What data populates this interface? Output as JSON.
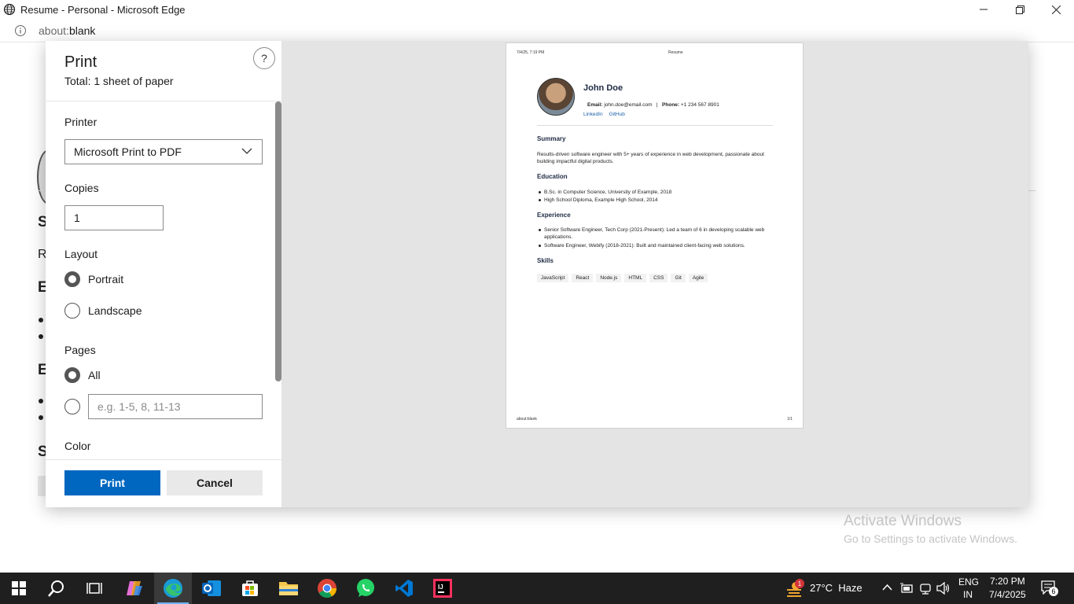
{
  "window": {
    "title": "Resume - Personal - Microsoft Edge"
  },
  "address": {
    "scheme": "about:",
    "rest": "blank"
  },
  "background": {
    "frag_s": "S",
    "frag_r": "R",
    "frag_e1": "E",
    "frag_e2": "E",
    "frag_s2": "S"
  },
  "print_panel": {
    "title": "Print",
    "total": "Total: 1 sheet of paper",
    "help": "?",
    "printer_label": "Printer",
    "printer_value": "Microsoft Print to PDF",
    "copies_label": "Copies",
    "copies_value": "1",
    "layout_label": "Layout",
    "layout_options": [
      "Portrait",
      "Landscape"
    ],
    "layout_selected": "Portrait",
    "pages_label": "Pages",
    "pages_all": "All",
    "pages_placeholder": "e.g. 1-5, 8, 11-13",
    "color_label": "Color",
    "print_button": "Print",
    "cancel_button": "Cancel"
  },
  "preview": {
    "header_left": "7/4/25, 7:19 PM",
    "header_center": "Resume",
    "footer_left": "about:blank",
    "footer_right": "1/1",
    "name": "John Doe",
    "email_label": "Email:",
    "email": "john.doe@email.com",
    "separator": "|",
    "phone_label": "Phone:",
    "phone": "+1 234 567 8901",
    "links": [
      "LinkedIn",
      "GitHub"
    ],
    "summary_title": "Summary",
    "summary_text": "Results-driven software engineer with 5+ years of experience in web development, passionate about building impactful digital products.",
    "education_title": "Education",
    "education": [
      "B.Sc. in Computer Science, University of Example, 2018",
      "High School Diploma, Example High School, 2014"
    ],
    "experience_title": "Experience",
    "experience": [
      "Senior Software Engineer, Tech Corp (2021-Present): Led a team of 6 in developing scalable web applications.",
      "Software Engineer, Webify (2018-2021): Built and maintained client-facing web solutions."
    ],
    "skills_title": "Skills",
    "skills": [
      "JavaScript",
      "React",
      "Node.js",
      "HTML",
      "CSS",
      "Git",
      "Agile"
    ]
  },
  "watermark": {
    "line1": "Activate Windows",
    "line2": "Go to Settings to activate Windows."
  },
  "taskbar": {
    "weather_badge": "1",
    "weather": "27°C  Haze",
    "lang_top": "ENG",
    "lang_bottom": "IN",
    "time": "7:20 PM",
    "date": "7/4/2025",
    "notifications": "6"
  }
}
